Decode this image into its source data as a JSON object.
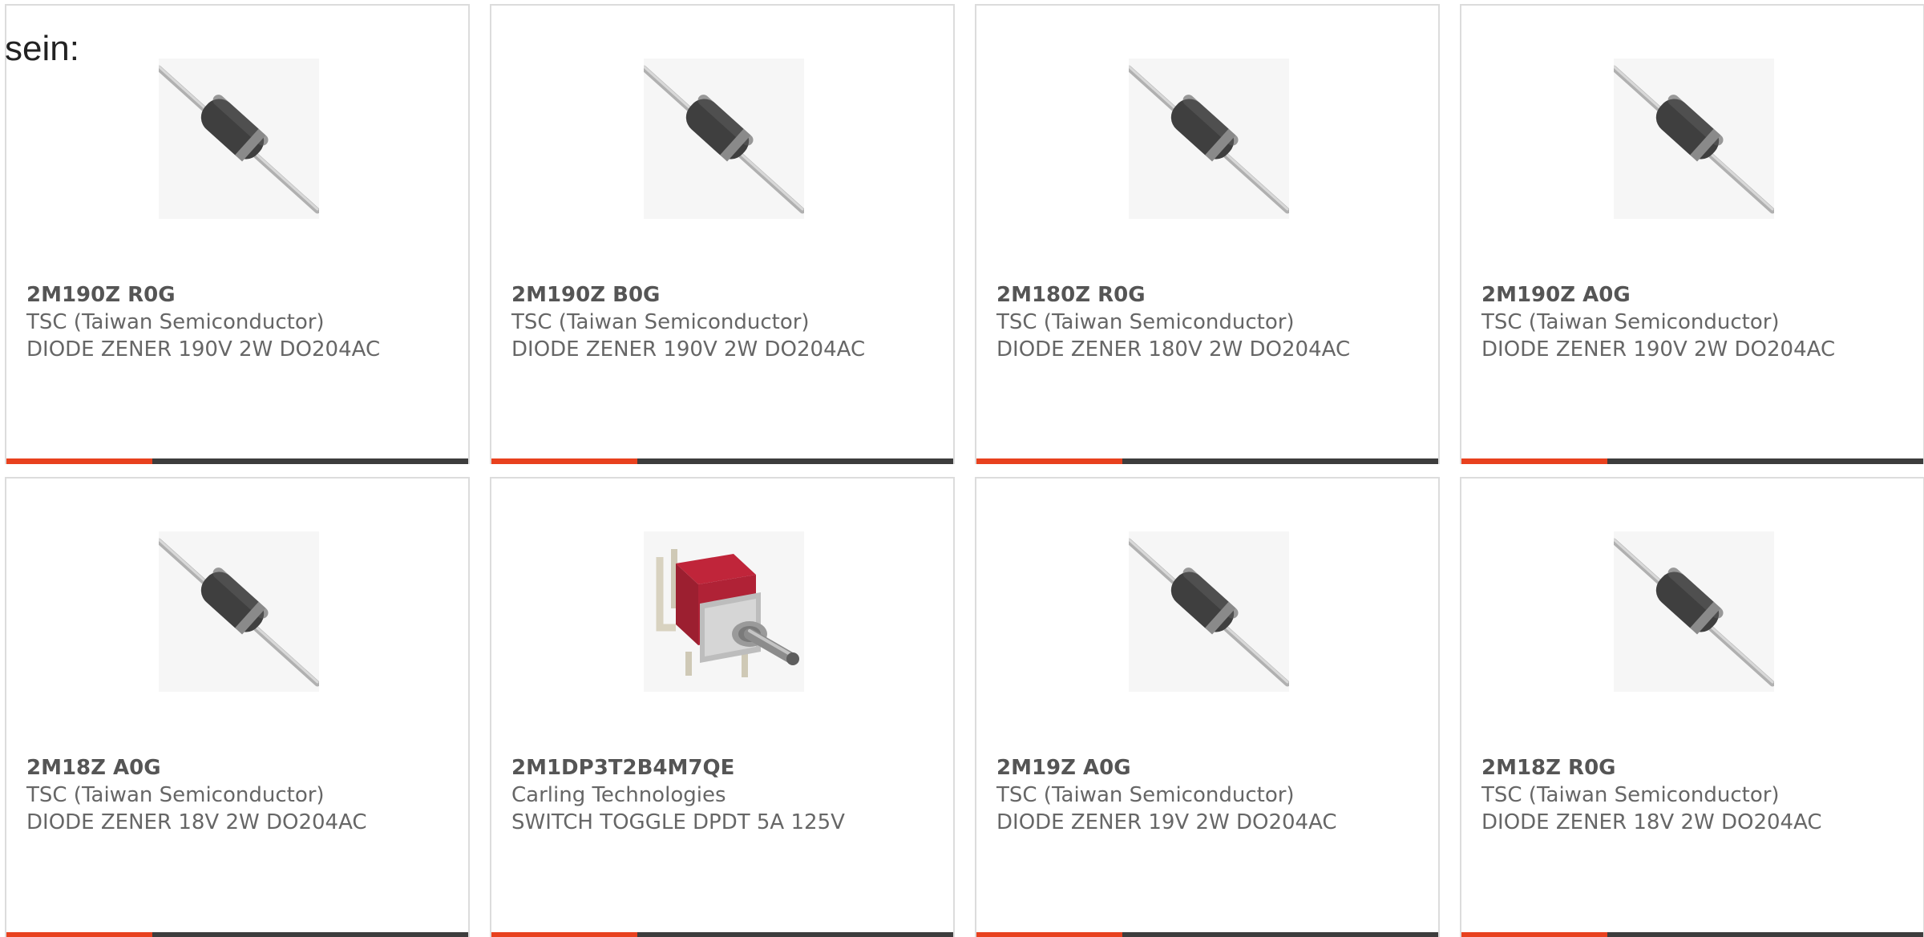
{
  "page": {
    "intro_text": "sein:"
  },
  "colors": {
    "accent": "#e8411e",
    "bar": "#3d3d3d",
    "border": "#dcdcdc",
    "text": "#666666"
  },
  "products": [
    {
      "part_number": "2M190Z R0G",
      "manufacturer": "TSC (Taiwan Semiconductor)",
      "description": "DIODE ZENER 190V 2W DO204AC",
      "image": "axial-diode-image"
    },
    {
      "part_number": "2M190Z B0G",
      "manufacturer": "TSC (Taiwan Semiconductor)",
      "description": "DIODE ZENER 190V 2W DO204AC",
      "image": "axial-diode-image"
    },
    {
      "part_number": "2M180Z R0G",
      "manufacturer": "TSC (Taiwan Semiconductor)",
      "description": "DIODE ZENER 180V 2W DO204AC",
      "image": "axial-diode-image"
    },
    {
      "part_number": "2M190Z A0G",
      "manufacturer": "TSC (Taiwan Semiconductor)",
      "description": "DIODE ZENER 190V 2W DO204AC",
      "image": "axial-diode-image"
    },
    {
      "part_number": "2M18Z A0G",
      "manufacturer": "TSC (Taiwan Semiconductor)",
      "description": "DIODE ZENER 18V 2W DO204AC",
      "image": "axial-diode-image"
    },
    {
      "part_number": "2M1DP3T2B4M7QE",
      "manufacturer": "Carling Technologies",
      "description": "SWITCH TOGGLE DPDT 5A 125V",
      "image": "toggle-switch-image"
    },
    {
      "part_number": "2M19Z A0G",
      "manufacturer": "TSC (Taiwan Semiconductor)",
      "description": "DIODE ZENER 19V 2W DO204AC",
      "image": "axial-diode-image"
    },
    {
      "part_number": "2M18Z R0G",
      "manufacturer": "TSC (Taiwan Semiconductor)",
      "description": "DIODE ZENER 18V 2W DO204AC",
      "image": "axial-diode-image"
    }
  ]
}
